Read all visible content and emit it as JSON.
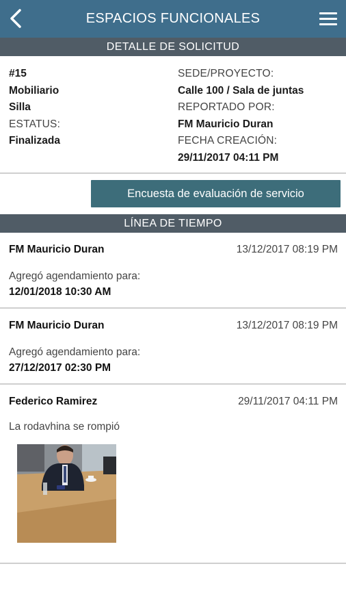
{
  "header": {
    "title": "ESPACIOS FUNCIONALES",
    "back_icon": "chevron-left-icon",
    "menu_icon": "hamburger-menu-icon"
  },
  "detail": {
    "section_title": "DETALLE DE SOLICITUD",
    "left": {
      "number": "#15",
      "category": "Mobiliario",
      "item": "Silla",
      "status_label": "ESTATUS:",
      "status_value": "Finalizada"
    },
    "right": {
      "site_label": "SEDE/PROYECTO:",
      "site_value": "Calle 100 / Sala de juntas",
      "reported_label": "REPORTADO POR:",
      "reported_value": "FM Mauricio Duran",
      "created_label": "FECHA CREACIÓN:",
      "created_value": "29/11/2017 04:11 PM"
    }
  },
  "survey_button": {
    "label": "Encuesta de evaluación de servicio"
  },
  "timeline": {
    "section_title": "LÍNEA DE TIEMPO",
    "entries": [
      {
        "author": "FM Mauricio Duran",
        "timestamp": "13/12/2017 08:19 PM",
        "message": "Agregó agendamiento para:",
        "value": "12/01/2018 10:30 AM"
      },
      {
        "author": "FM Mauricio Duran",
        "timestamp": "13/12/2017 08:19 PM",
        "message": "Agregó agendamiento para:",
        "value": "27/12/2017 02:30 PM"
      },
      {
        "author": "Federico Ramirez",
        "timestamp": "29/11/2017 04:11 PM",
        "message": "La rodavhina se rompió",
        "attachment": "photo-thumbnail"
      }
    ]
  },
  "colors": {
    "appbar": "#3f6e8c",
    "section_bar": "#505c66",
    "button": "#3d6d7a"
  }
}
